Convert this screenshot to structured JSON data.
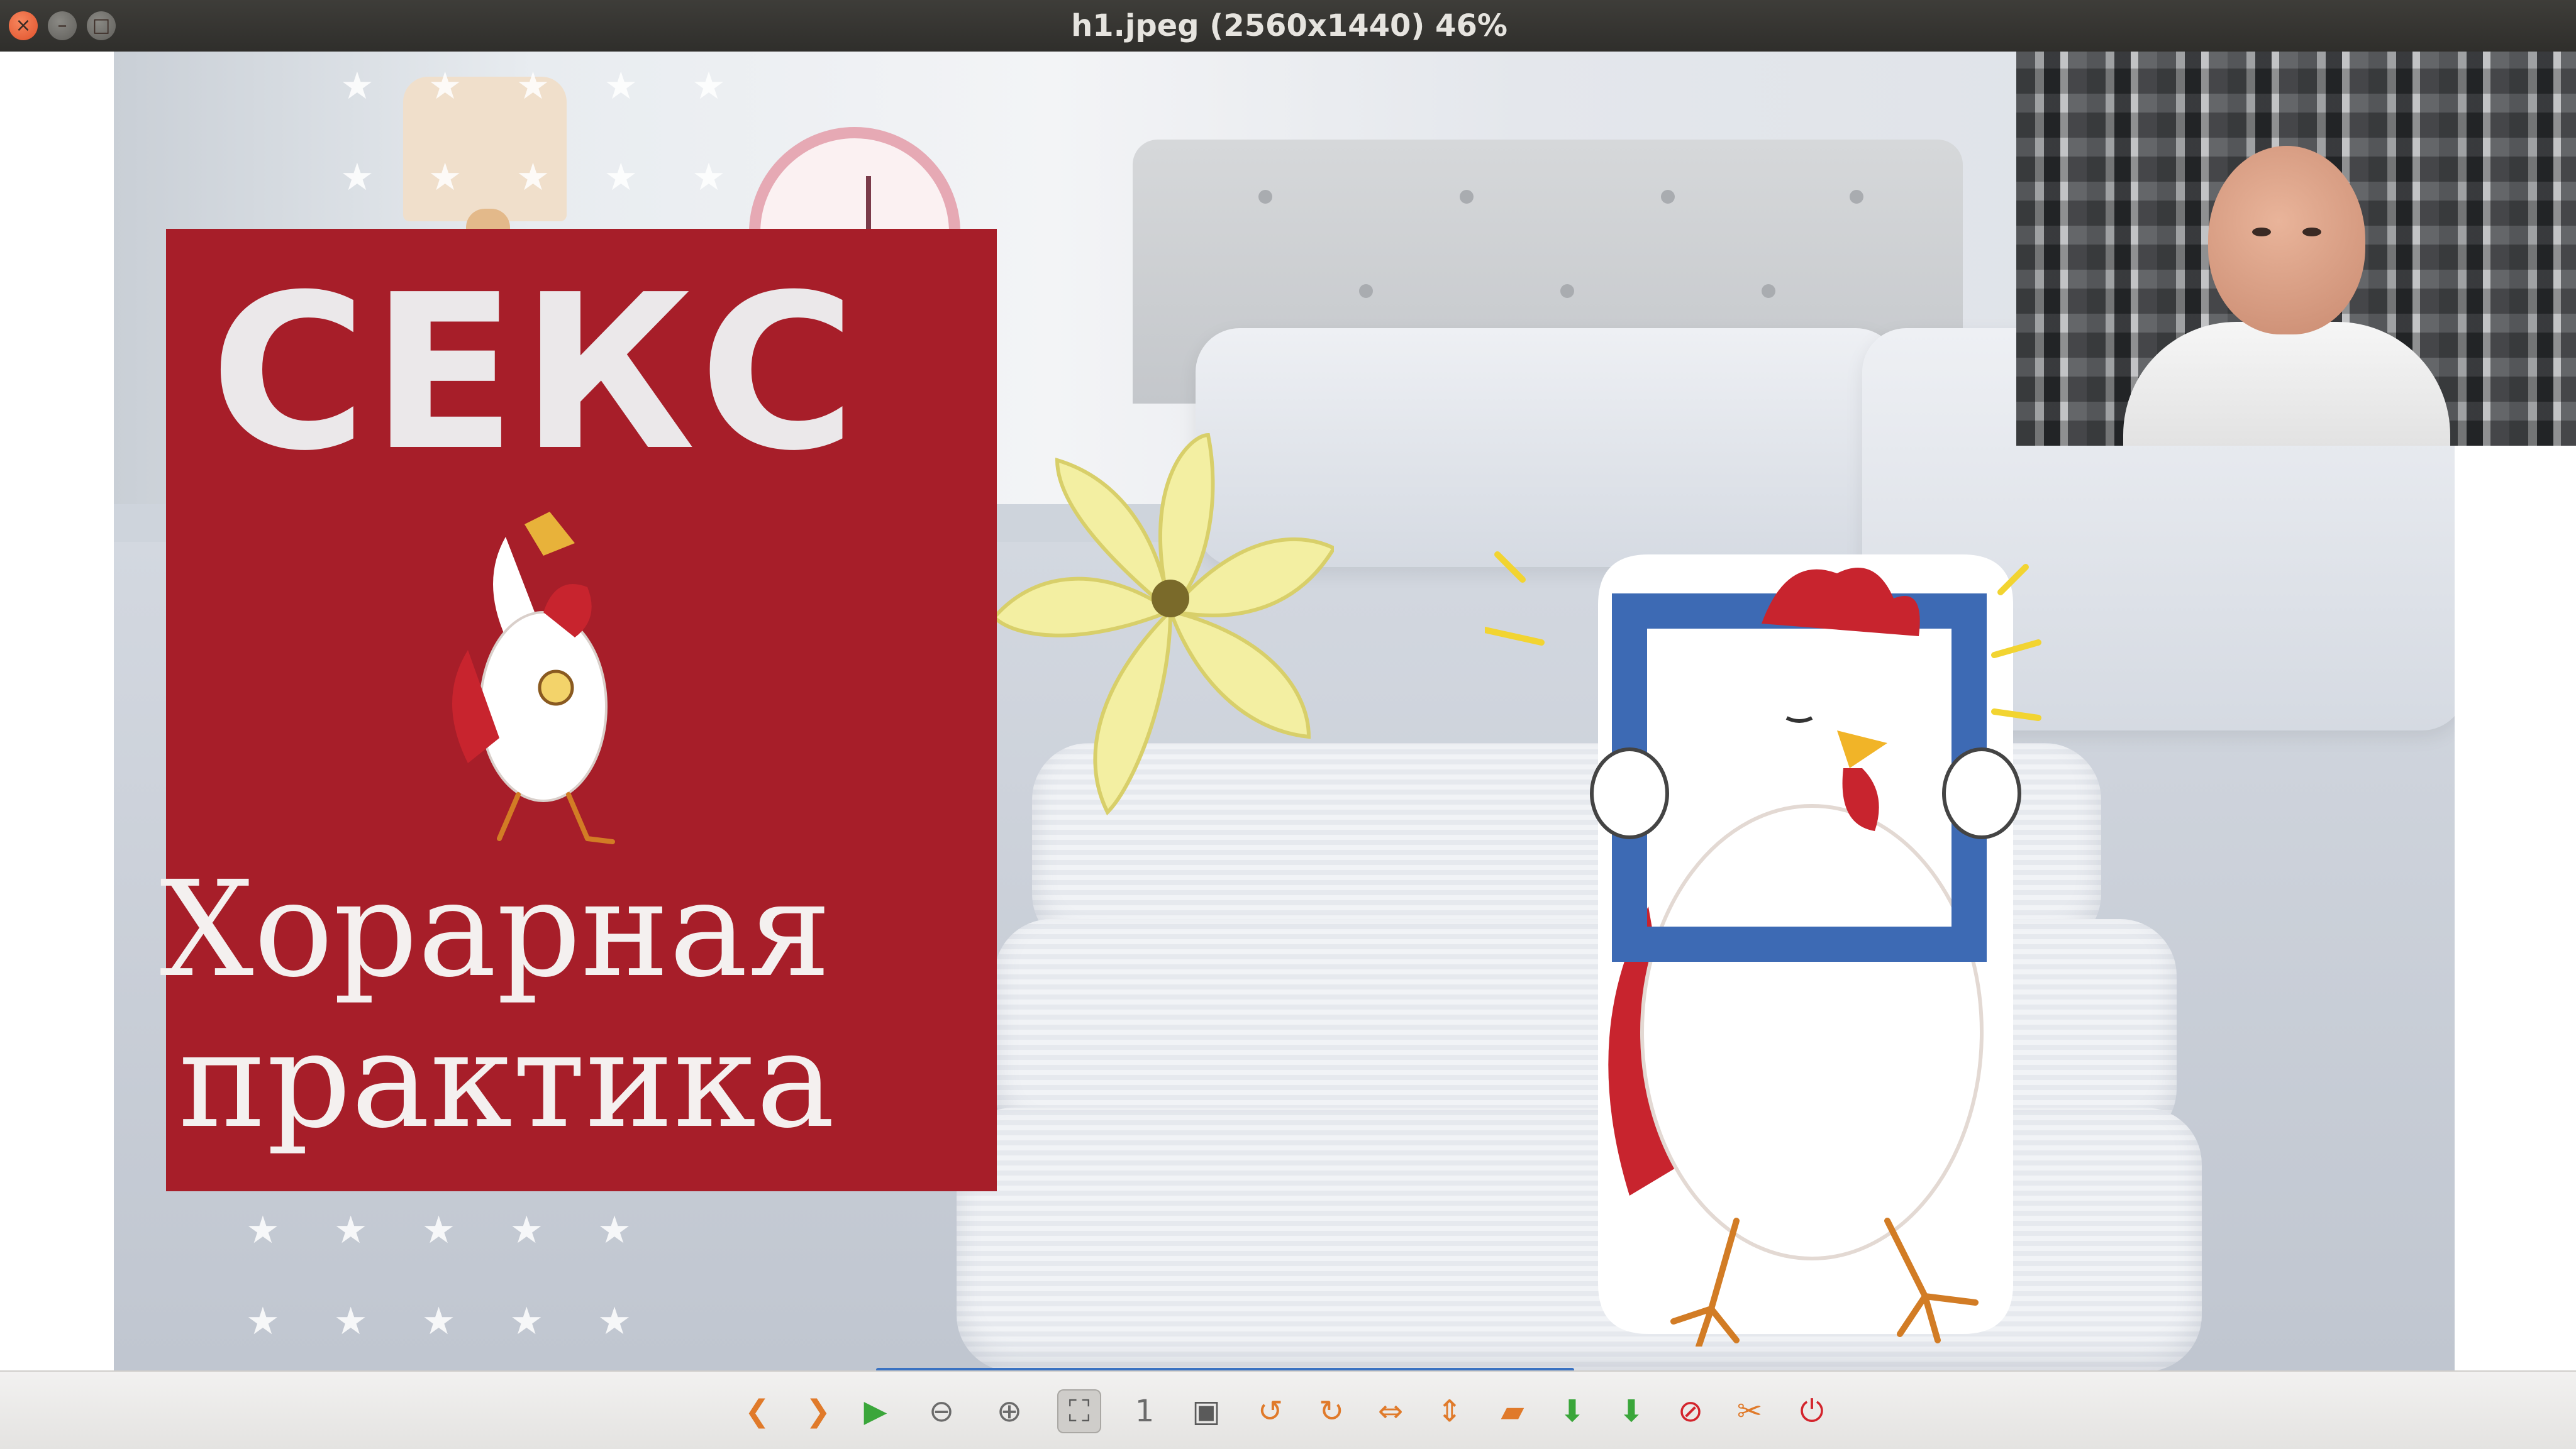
{
  "window": {
    "title": "h1.jpeg (2560x1440) 46%",
    "buttons": {
      "close": "×",
      "minimize": "–",
      "maximize": "□"
    }
  },
  "image": {
    "headline": "СЕКС",
    "subtitle_line1": "Хорарная",
    "subtitle_line2": "практика",
    "stars": "★★★★★"
  },
  "colors": {
    "card_red": "#a71e29",
    "headline_text": "#ebe8ea",
    "toolbar_accent": "#3a72c2"
  },
  "toolbar": {
    "buttons": [
      {
        "name": "previous-image-button",
        "icon": "chevron-left-icon",
        "glyph": "❮",
        "color": "#e07a2a"
      },
      {
        "name": "next-image-button",
        "icon": "chevron-right-icon",
        "glyph": "❯",
        "color": "#e07a2a"
      },
      {
        "name": "slideshow-button",
        "icon": "play-icon",
        "glyph": "▶",
        "color": "#3aa63a"
      },
      {
        "name": "zoom-out-button",
        "icon": "zoom-out-icon",
        "glyph": "⊖",
        "color": "#6b6b6b"
      },
      {
        "name": "zoom-in-button",
        "icon": "zoom-in-icon",
        "glyph": "⊕",
        "color": "#6b6b6b"
      },
      {
        "name": "best-fit-button",
        "icon": "fit-window-icon",
        "glyph": "⛶",
        "color": "#5a5a5a"
      },
      {
        "name": "original-size-button",
        "icon": "one-to-one-icon",
        "glyph": "1",
        "color": "#6b6b6b"
      },
      {
        "name": "fullscreen-button",
        "icon": "fullscreen-icon",
        "glyph": "▣",
        "color": "#5a5a5a"
      },
      {
        "name": "rotate-left-button",
        "icon": "rotate-left-icon",
        "glyph": "↺",
        "color": "#e07a2a"
      },
      {
        "name": "rotate-right-button",
        "icon": "rotate-right-icon",
        "glyph": "↻",
        "color": "#e07a2a"
      },
      {
        "name": "flip-horizontal-button",
        "icon": "flip-horizontal-icon",
        "glyph": "⇔",
        "color": "#e07a2a"
      },
      {
        "name": "flip-vertical-button",
        "icon": "flip-vertical-icon",
        "glyph": "⇕",
        "color": "#e07a2a"
      },
      {
        "name": "open-file-button",
        "icon": "folder-icon",
        "glyph": "▰",
        "color": "#e07a2a"
      },
      {
        "name": "save-file-button",
        "icon": "save-icon",
        "glyph": "⬇",
        "color": "#3aa63a"
      },
      {
        "name": "save-as-button",
        "icon": "save-as-icon",
        "glyph": "⬇",
        "color": "#3aa63a"
      },
      {
        "name": "delete-button",
        "icon": "delete-icon",
        "glyph": "⊘",
        "color": "#d3242c"
      },
      {
        "name": "preferences-button",
        "icon": "tools-icon",
        "glyph": "✂",
        "color": "#e07a2a"
      },
      {
        "name": "quit-button",
        "icon": "power-icon",
        "glyph": "⏻",
        "color": "#d3242c"
      }
    ]
  }
}
